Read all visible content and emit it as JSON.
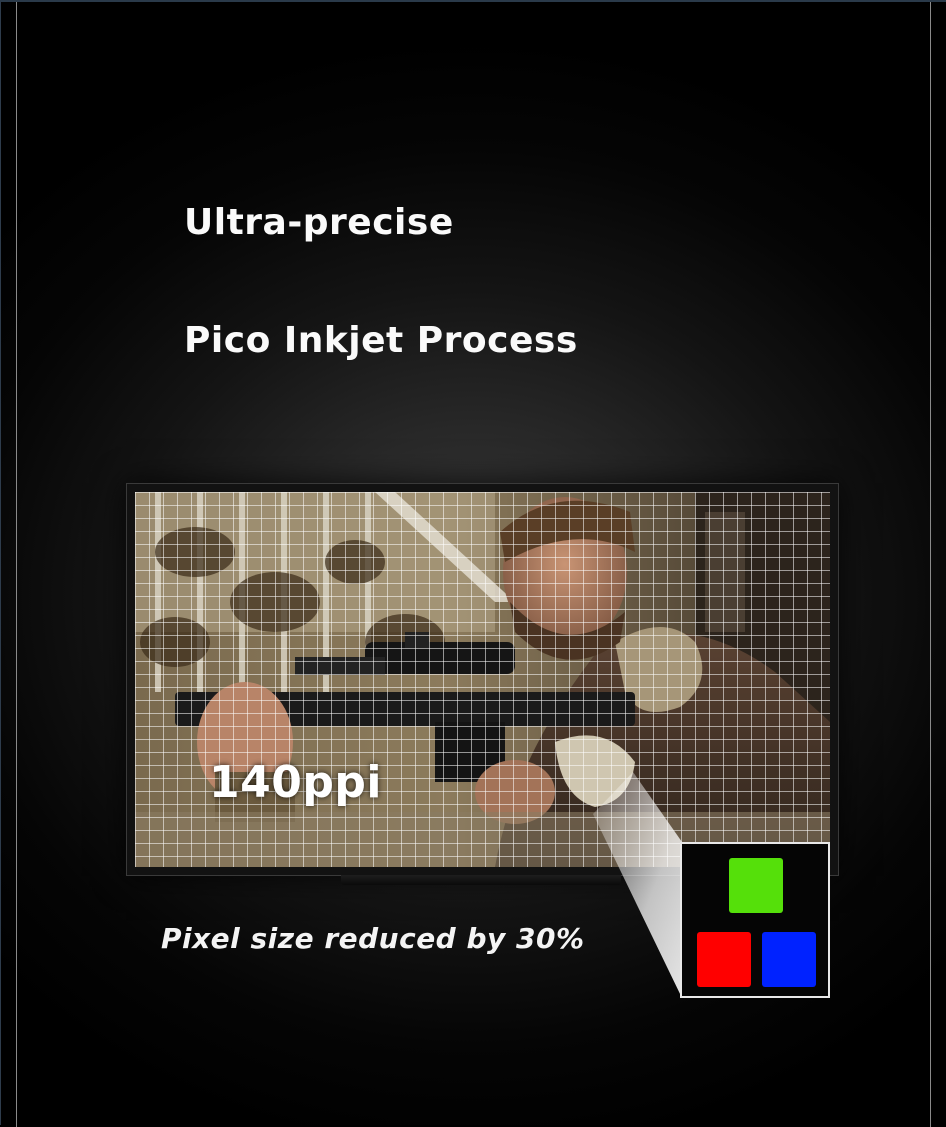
{
  "heading": {
    "line1": "Ultra-precise",
    "line2": "Pico Inkjet Process"
  },
  "display": {
    "resolution_label": "140ppi",
    "image_description": "man-aiming-rifle"
  },
  "caption": "Pixel size reduced by 30%",
  "subpixels": [
    {
      "name": "green",
      "color": "#55e00a"
    },
    {
      "name": "red",
      "color": "#ff0000"
    },
    {
      "name": "blue",
      "color": "#0022ff"
    }
  ],
  "colors": {
    "background": "#000000",
    "text": "#ffffff"
  }
}
